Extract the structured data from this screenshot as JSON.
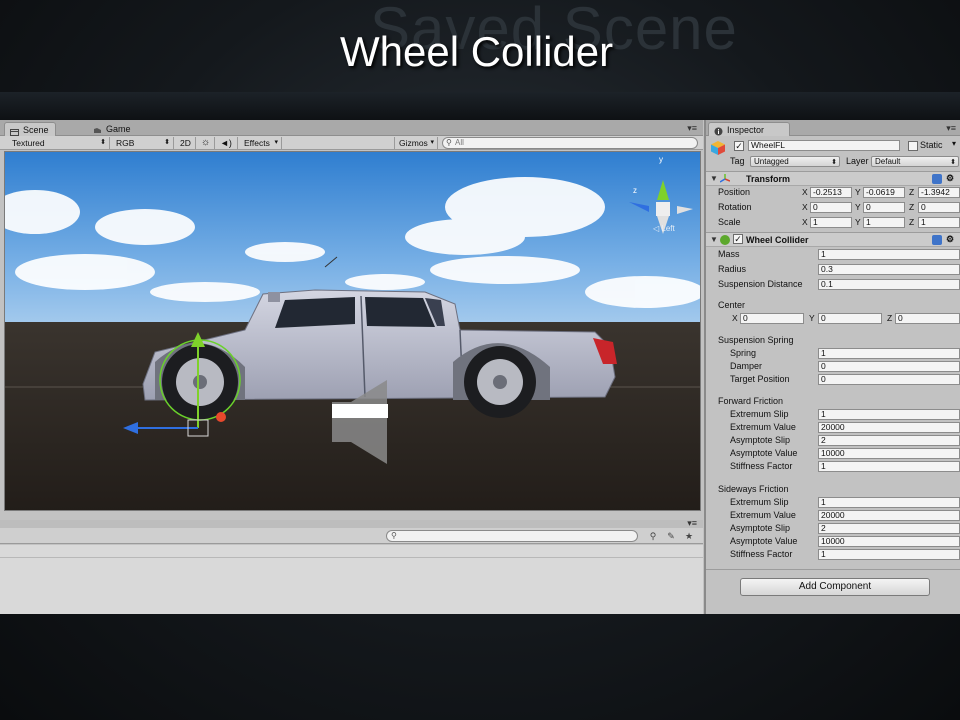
{
  "slide": {
    "ghost_title": "Saved Scene",
    "title": "Wheel Collider"
  },
  "scene": {
    "tabs": [
      {
        "label": "Scene",
        "icon": "scene-icon",
        "active": true
      },
      {
        "label": "Game",
        "icon": "game-icon",
        "active": false
      }
    ],
    "toolbar": {
      "render_mode": "Textured",
      "color_mode": "RGB",
      "mode_2d": "2D",
      "effects": "Effects",
      "gizmos": "Gizmos",
      "search_placeholder": "All"
    },
    "gizmo_labels": {
      "y": "y",
      "z": "z",
      "view": "Left"
    }
  },
  "console": {
    "search_placeholder": ""
  },
  "inspector": {
    "tab_label": "Inspector",
    "object_name": "WheelFL",
    "static_label": "Static",
    "tag_label": "Tag",
    "tag_value": "Untagged",
    "layer_label": "Layer",
    "layer_value": "Default",
    "transform": {
      "title": "Transform",
      "position_label": "Position",
      "rotation_label": "Rotation",
      "scale_label": "Scale",
      "position": {
        "x": "-0.2513",
        "y": "-0.0619",
        "z": "-1.3942"
      },
      "rotation": {
        "x": "0",
        "y": "0",
        "z": "0"
      },
      "scale": {
        "x": "1",
        "y": "1",
        "z": "1"
      }
    },
    "wheel_collider": {
      "title": "Wheel Collider",
      "mass_label": "Mass",
      "mass": "1",
      "radius_label": "Radius",
      "radius": "0.3",
      "suspension_distance_label": "Suspension Distance",
      "suspension_distance": "0.1",
      "center_label": "Center",
      "center": {
        "x": "0",
        "y": "0",
        "z": "0"
      },
      "suspension_spring_label": "Suspension Spring",
      "spring_label": "Spring",
      "spring": "1",
      "damper_label": "Damper",
      "damper": "0",
      "target_position_label": "Target Position",
      "target_position": "0",
      "forward_friction_label": "Forward Friction",
      "forward": {
        "extremum_slip_label": "Extremum Slip",
        "extremum_slip": "1",
        "extremum_value_label": "Extremum Value",
        "extremum_value": "20000",
        "asymptote_slip_label": "Asymptote Slip",
        "asymptote_slip": "2",
        "asymptote_value_label": "Asymptote Value",
        "asymptote_value": "10000",
        "stiffness_factor_label": "Stiffness Factor",
        "stiffness_factor": "1"
      },
      "sideways_friction_label": "Sideways Friction",
      "sideways": {
        "extremum_slip_label": "Extremum Slip",
        "extremum_slip": "1",
        "extremum_value_label": "Extremum Value",
        "extremum_value": "20000",
        "asymptote_slip_label": "Asymptote Slip",
        "asymptote_slip": "2",
        "asymptote_value_label": "Asymptote Value",
        "asymptote_value": "10000",
        "stiffness_factor_label": "Stiffness Factor",
        "stiffness_factor": "1"
      }
    },
    "add_component_label": "Add Component",
    "axis": {
      "x": "X",
      "y": "Y",
      "z": "Z"
    }
  },
  "colors": {
    "sky_top": "#3a86d6",
    "sky_bottom": "#9cc6ec",
    "ground": "#2b2520",
    "truck_body": "#b9bccb",
    "gizmo_green": "#7fd12a",
    "gizmo_red": "#e8492c",
    "gizmo_blue": "#2f6fe0"
  }
}
